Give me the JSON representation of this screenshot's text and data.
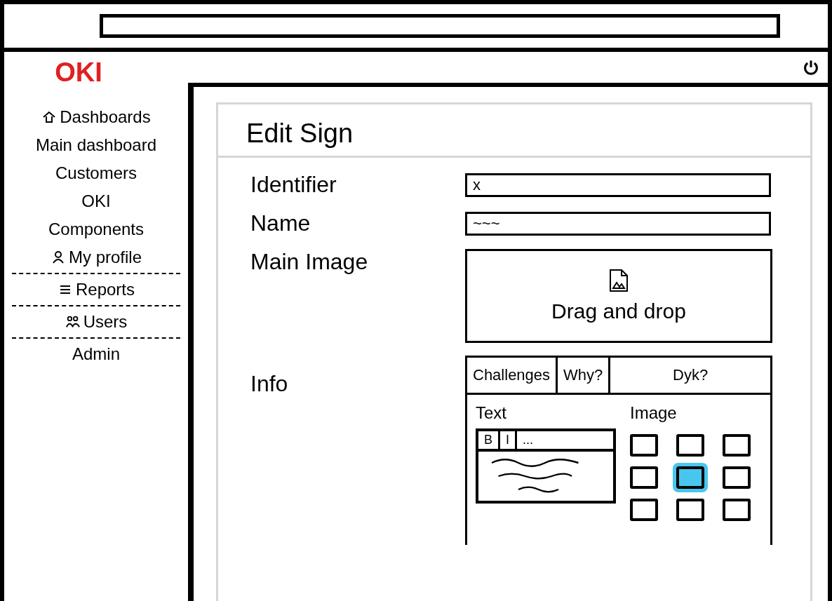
{
  "brand": "OKI",
  "sidebar": {
    "items": [
      {
        "label": "Dashboards",
        "kind": "home",
        "divider_after": false
      },
      {
        "label": "Main dashboard",
        "kind": "plain",
        "divider_after": false
      },
      {
        "label": "Customers",
        "kind": "plain",
        "divider_after": false
      },
      {
        "label": "OKI",
        "kind": "plain",
        "divider_after": false
      },
      {
        "label": "Components",
        "kind": "plain",
        "divider_after": false
      },
      {
        "label": "My profile",
        "kind": "profile",
        "divider_after": true
      },
      {
        "label": "Reports",
        "kind": "reports",
        "divider_after": true
      },
      {
        "label": "Users",
        "kind": "users",
        "divider_after": true
      },
      {
        "label": "Admin",
        "kind": "plain",
        "divider_after": false
      }
    ]
  },
  "page": {
    "title": "Edit Sign",
    "fields": [
      {
        "label": "Identifier",
        "value": "x"
      },
      {
        "label": "Name",
        "value": "~~~"
      }
    ],
    "main_image": {
      "label": "Main Image",
      "dropzone": "Drag and drop"
    },
    "info": {
      "label": "Info",
      "tabs": [
        {
          "label": "Challenges"
        },
        {
          "label": "Why?"
        },
        {
          "label": "Dyk?"
        }
      ],
      "text_label": "Text",
      "toolbar": [
        "B",
        "I",
        "..."
      ],
      "image_label": "Image",
      "images": [
        {
          "selected": false
        },
        {
          "selected": false
        },
        {
          "selected": false
        },
        {
          "selected": false
        },
        {
          "selected": true
        },
        {
          "selected": false
        },
        {
          "selected": false
        },
        {
          "selected": false
        },
        {
          "selected": false
        }
      ]
    }
  }
}
